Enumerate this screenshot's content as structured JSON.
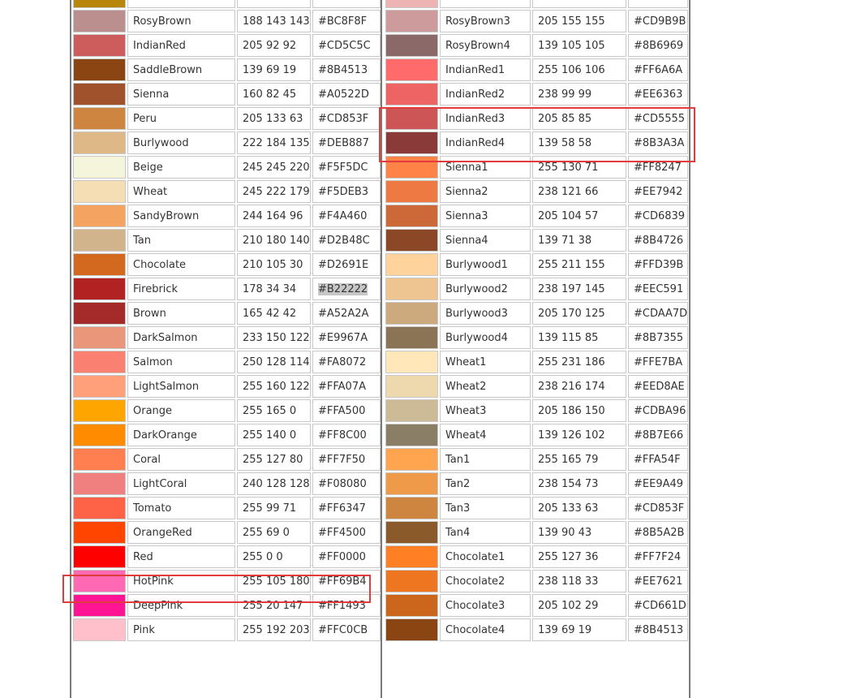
{
  "accent_color": "#e23b3b",
  "left_table": {
    "rows": [
      {
        "swatch": "#B8860B",
        "name": "",
        "rgb": "",
        "hex": ""
      },
      {
        "swatch": "#BC8F8F",
        "name": "RosyBrown",
        "rgb": "188 143 143",
        "hex": "#BC8F8F"
      },
      {
        "swatch": "#CD5C5C",
        "name": "IndianRed",
        "rgb": "205 92 92",
        "hex": "#CD5C5C"
      },
      {
        "swatch": "#8B4513",
        "name": "SaddleBrown",
        "rgb": "139 69 19",
        "hex": "#8B4513"
      },
      {
        "swatch": "#A0522D",
        "name": "Sienna",
        "rgb": "160 82 45",
        "hex": "#A0522D"
      },
      {
        "swatch": "#CD853F",
        "name": "Peru",
        "rgb": "205 133 63",
        "hex": "#CD853F"
      },
      {
        "swatch": "#DEB887",
        "name": "Burlywood",
        "rgb": "222 184 135",
        "hex": "#DEB887"
      },
      {
        "swatch": "#F5F5DC",
        "name": "Beige",
        "rgb": "245 245 220",
        "hex": "#F5F5DC"
      },
      {
        "swatch": "#F5DEB3",
        "name": "Wheat",
        "rgb": "245 222 179",
        "hex": "#F5DEB3"
      },
      {
        "swatch": "#F4A460",
        "name": "SandyBrown",
        "rgb": "244 164 96",
        "hex": "#F4A460"
      },
      {
        "swatch": "#D2B48C",
        "name": "Tan",
        "rgb": "210 180 140",
        "hex": "#D2B48C"
      },
      {
        "swatch": "#D2691E",
        "name": "Chocolate",
        "rgb": "210 105 30",
        "hex": "#D2691E"
      },
      {
        "swatch": "#B22222",
        "name": "Firebrick",
        "rgb": "178 34 34",
        "hex": "#B22222",
        "hex_highlighted": true
      },
      {
        "swatch": "#A52A2A",
        "name": "Brown",
        "rgb": "165 42 42",
        "hex": "#A52A2A"
      },
      {
        "swatch": "#E9967A",
        "name": "DarkSalmon",
        "rgb": "233 150 122",
        "hex": "#E9967A"
      },
      {
        "swatch": "#FA8072",
        "name": "Salmon",
        "rgb": "250 128 114",
        "hex": "#FA8072"
      },
      {
        "swatch": "#FFA07A",
        "name": "LightSalmon",
        "rgb": "255 160 122",
        "hex": "#FFA07A"
      },
      {
        "swatch": "#FFA500",
        "name": "Orange",
        "rgb": "255 165 0",
        "hex": "#FFA500"
      },
      {
        "swatch": "#FF8C00",
        "name": "DarkOrange",
        "rgb": "255 140 0",
        "hex": "#FF8C00"
      },
      {
        "swatch": "#FF7F50",
        "name": "Coral",
        "rgb": "255 127 80",
        "hex": "#FF7F50"
      },
      {
        "swatch": "#F08080",
        "name": "LightCoral",
        "rgb": "240 128 128",
        "hex": "#F08080"
      },
      {
        "swatch": "#FF6347",
        "name": "Tomato",
        "rgb": "255 99 71",
        "hex": "#FF6347"
      },
      {
        "swatch": "#FF4500",
        "name": "OrangeRed",
        "rgb": "255 69 0",
        "hex": "#FF4500"
      },
      {
        "swatch": "#FF0000",
        "name": "Red",
        "rgb": "255 0 0",
        "hex": "#FF0000"
      },
      {
        "swatch": "#FF69B4",
        "name": "HotPink",
        "rgb": "255 105 180",
        "hex": "#FF69B4"
      },
      {
        "swatch": "#FF1493",
        "name": "DeepPink",
        "rgb": "255 20 147",
        "hex": "#FF1493"
      },
      {
        "swatch": "#FFC0CB",
        "name": "Pink",
        "rgb": "255 192 203",
        "hex": "#FFC0CB"
      }
    ]
  },
  "right_table": {
    "rows": [
      {
        "swatch": "#EEB4B4",
        "name": "",
        "rgb": "",
        "hex": ""
      },
      {
        "swatch": "#CD9B9B",
        "name": "RosyBrown3",
        "rgb": "205 155 155",
        "hex": "#CD9B9B"
      },
      {
        "swatch": "#8B6969",
        "name": "RosyBrown4",
        "rgb": "139 105 105",
        "hex": "#8B6969"
      },
      {
        "swatch": "#FF6A6A",
        "name": "IndianRed1",
        "rgb": "255 106 106",
        "hex": "#FF6A6A"
      },
      {
        "swatch": "#EE6363",
        "name": "IndianRed2",
        "rgb": "238 99 99",
        "hex": "#EE6363"
      },
      {
        "swatch": "#CD5555",
        "name": "IndianRed3",
        "rgb": "205 85 85",
        "hex": "#CD5555"
      },
      {
        "swatch": "#8B3A3A",
        "name": "IndianRed4",
        "rgb": "139 58 58",
        "hex": "#8B3A3A"
      },
      {
        "swatch": "#FF8247",
        "name": "Sienna1",
        "rgb": "255 130 71",
        "hex": "#FF8247"
      },
      {
        "swatch": "#EE7942",
        "name": "Sienna2",
        "rgb": "238 121 66",
        "hex": "#EE7942"
      },
      {
        "swatch": "#CD6839",
        "name": "Sienna3",
        "rgb": "205 104 57",
        "hex": "#CD6839"
      },
      {
        "swatch": "#8B4726",
        "name": "Sienna4",
        "rgb": "139 71 38",
        "hex": "#8B4726"
      },
      {
        "swatch": "#FFD39B",
        "name": "Burlywood1",
        "rgb": "255 211 155",
        "hex": "#FFD39B"
      },
      {
        "swatch": "#EEC591",
        "name": "Burlywood2",
        "rgb": "238 197 145",
        "hex": "#EEC591"
      },
      {
        "swatch": "#CDAA7D",
        "name": "Burlywood3",
        "rgb": "205 170 125",
        "hex": "#CDAA7D"
      },
      {
        "swatch": "#8B7355",
        "name": "Burlywood4",
        "rgb": "139 115 85",
        "hex": "#8B7355"
      },
      {
        "swatch": "#FFE7BA",
        "name": "Wheat1",
        "rgb": "255 231 186",
        "hex": "#FFE7BA"
      },
      {
        "swatch": "#EED8AE",
        "name": "Wheat2",
        "rgb": "238 216 174",
        "hex": "#EED8AE"
      },
      {
        "swatch": "#CDBA96",
        "name": "Wheat3",
        "rgb": "205 186 150",
        "hex": "#CDBA96"
      },
      {
        "swatch": "#8B7E66",
        "name": "Wheat4",
        "rgb": "139 126 102",
        "hex": "#8B7E66"
      },
      {
        "swatch": "#FFA54F",
        "name": "Tan1",
        "rgb": "255 165 79",
        "hex": "#FFA54F"
      },
      {
        "swatch": "#EE9A49",
        "name": "Tan2",
        "rgb": "238 154 73",
        "hex": "#EE9A49"
      },
      {
        "swatch": "#CD853F",
        "name": "Tan3",
        "rgb": "205 133 63",
        "hex": "#CD853F"
      },
      {
        "swatch": "#8B5A2B",
        "name": "Tan4",
        "rgb": "139 90 43",
        "hex": "#8B5A2B"
      },
      {
        "swatch": "#FF7F24",
        "name": "Chocolate1",
        "rgb": "255 127 36",
        "hex": "#FF7F24"
      },
      {
        "swatch": "#EE7621",
        "name": "Chocolate2",
        "rgb": "238 118 33",
        "hex": "#EE7621"
      },
      {
        "swatch": "#CD661D",
        "name": "Chocolate3",
        "rgb": "205 102 29",
        "hex": "#CD661D"
      },
      {
        "swatch": "#8B4513",
        "name": "Chocolate4",
        "rgb": "139 69 19",
        "hex": "#8B4513"
      }
    ]
  }
}
